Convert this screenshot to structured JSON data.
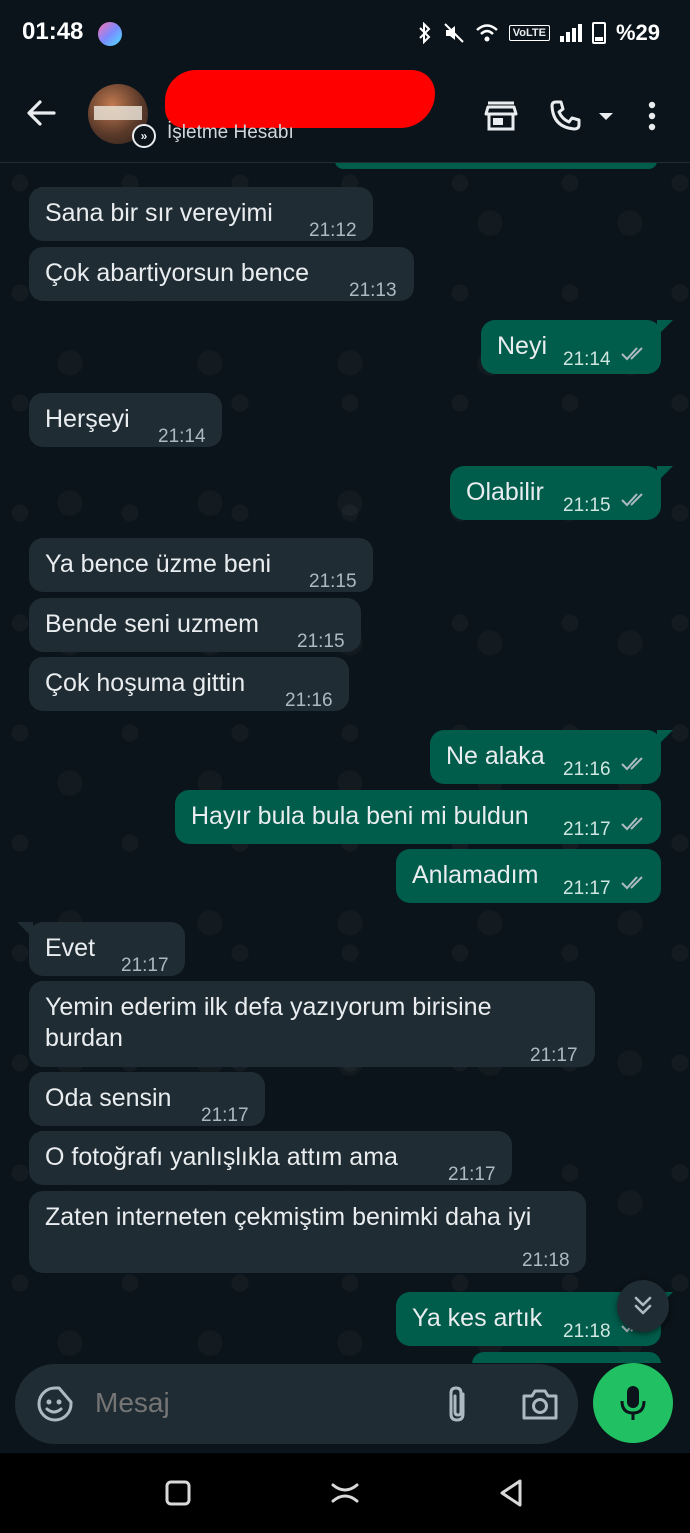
{
  "status_bar": {
    "time": "01:48",
    "network_badge": "VoLTE",
    "battery": "%29"
  },
  "header": {
    "subtitle": "İşletme Hesabı",
    "back_icon": "arrow-left-icon",
    "store_icon": "storefront-icon",
    "call_icon": "phone-icon",
    "menu_icon": "kebab-menu-icon"
  },
  "messages": [
    {
      "dir": "in",
      "text": "Sana bir sır vereyimi",
      "time": "21:12"
    },
    {
      "dir": "in",
      "text": "Çok abartiyorsun bence",
      "time": "21:13"
    },
    {
      "dir": "out",
      "text": "Neyi",
      "time": "21:14"
    },
    {
      "dir": "in",
      "text": "Herşeyi",
      "time": "21:14"
    },
    {
      "dir": "out",
      "text": "Olabilir",
      "time": "21:15"
    },
    {
      "dir": "in",
      "text": "Ya bence üzme beni",
      "time": "21:15"
    },
    {
      "dir": "in",
      "text": "Bende seni uzmem",
      "time": "21:15"
    },
    {
      "dir": "in",
      "text": "Çok hoşuma gittin",
      "time": "21:16"
    },
    {
      "dir": "out",
      "text": "Ne alaka",
      "time": "21:16"
    },
    {
      "dir": "out",
      "text": "Hayır bula bula beni mi buldun",
      "time": "21:17"
    },
    {
      "dir": "out",
      "text": "Anlamadım",
      "time": "21:17"
    },
    {
      "dir": "in",
      "text": "Evet",
      "time": "21:17"
    },
    {
      "dir": "in",
      "text_line1": "Yemin ederim ilk defa yazıyorum birisine",
      "text_line2": "burdan",
      "time": "21:17"
    },
    {
      "dir": "in",
      "text": "Oda sensin",
      "time": "21:17"
    },
    {
      "dir": "in",
      "text": "O fotoğrafı yanlışlıkla attım ama",
      "time": "21:17"
    },
    {
      "dir": "in",
      "text": "Zaten interneten çekmiştim benimki daha iyi",
      "time": "21:18"
    },
    {
      "dir": "out",
      "text": "Ya kes artık",
      "time": "21:18"
    }
  ],
  "composer": {
    "placeholder": "Mesaj"
  },
  "colors": {
    "incoming": "#202c33",
    "outgoing": "#005c4b",
    "mic": "#21c063",
    "background": "#0b141a"
  }
}
